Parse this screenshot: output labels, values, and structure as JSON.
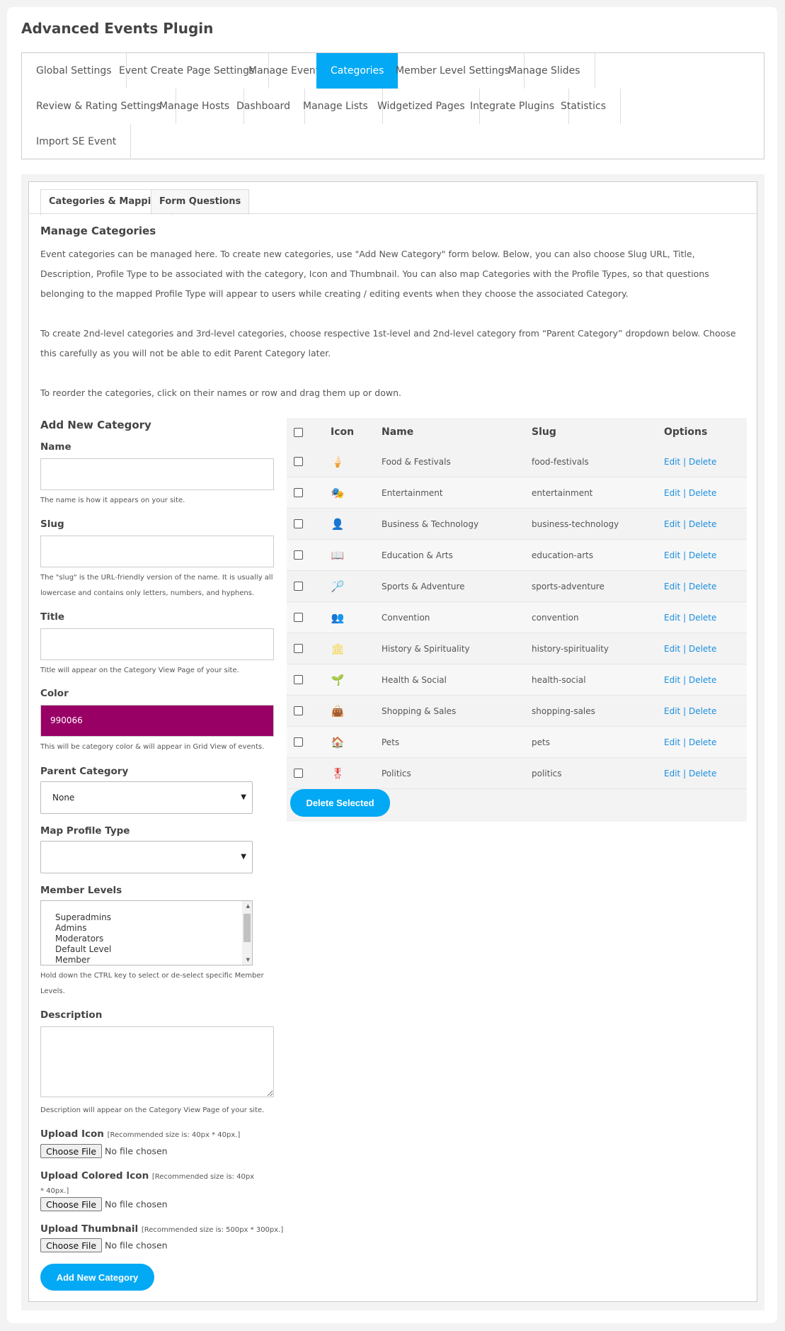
{
  "title": "Advanced Events Plugin",
  "tabs": [
    {
      "label": "Global Settings"
    },
    {
      "label": "Event Create Page Settings"
    },
    {
      "label": "Manage Events"
    },
    {
      "label": "Categories",
      "active": true
    },
    {
      "label": "Member Level Settings"
    },
    {
      "label": "Manage Slides"
    },
    {
      "label": "Review & Rating Settings"
    },
    {
      "label": "Manage Hosts"
    },
    {
      "label": "Dashboard"
    },
    {
      "label": "Manage Lists"
    },
    {
      "label": "Widgetized Pages"
    },
    {
      "label": "Integrate Plugins"
    },
    {
      "label": "Statistics"
    },
    {
      "label": "Import SE Event"
    }
  ],
  "subtabs": [
    {
      "label": "Categories & Mapping",
      "active": true
    },
    {
      "label": "Form Questions"
    }
  ],
  "heading": "Manage Categories",
  "paragraphs": [
    "Event categories can be managed here. To create new categories, use \"Add New Category\" form below. Below, you can also choose Slug URL, Title, Description, Profile Type to be associated with the category, Icon and Thumbnail. You can also map Categories with the Profile Types, so that questions belonging to the mapped Profile Type will appear to users while creating / editing events when they choose the associated Category.",
    "To create 2nd-level categories and 3rd-level categories, choose respective 1st-level and 2nd-level category from “Parent Category” dropdown below. Choose this carefully as you will not be able to edit Parent Category later.",
    "To reorder the categories, click on their names or row and drag them up or down."
  ],
  "form": {
    "heading": "Add New Category",
    "name_label": "Name",
    "name_value": "",
    "name_hint": "The name is how it appears on your site.",
    "slug_label": "Slug",
    "slug_value": "",
    "slug_hint": "The \"slug\" is the URL-friendly version of the name. It is usually all lowercase and contains only letters, numbers, and hyphens.",
    "title_label": "Title",
    "title_value": "",
    "title_hint": "Title will appear on the Category View Page of your site.",
    "color_label": "Color",
    "color_value": "990066",
    "color_hex": "#990066",
    "color_hint": "This will be category color & will appear in Grid View of events.",
    "parent_label": "Parent Category",
    "parent_value": "None",
    "profile_label": "Map Profile Type",
    "profile_value": "",
    "levels_label": "Member Levels",
    "levels": [
      "Superadmins",
      "Admins",
      "Moderators",
      "Default Level",
      "Member"
    ],
    "levels_hint": "Hold down the CTRL key to select or de-select specific Member Levels.",
    "desc_label": "Description",
    "desc_hint": "Description will appear on the Category View Page of your site.",
    "icon_label": "Upload Icon",
    "icon_note": "[Recommended size is: 40px * 40px.]",
    "colored_label": "Upload Colored Icon",
    "colored_note": "[Recommended size is: 40px * 40px.]",
    "thumb_label": "Upload Thumbnail",
    "thumb_note": "[Recommended size is: 500px * 300px.]",
    "choose_file": "Choose File",
    "no_file": "No file chosen",
    "submit": "Add New Category"
  },
  "table": {
    "headers": {
      "icon": "Icon",
      "name": "Name",
      "slug": "Slug",
      "options": "Options"
    },
    "edit": "Edit",
    "sep": "|",
    "delete": "Delete",
    "rows": [
      {
        "name": "Food & Festivals",
        "slug": "food-festivals",
        "icon": "food-icon",
        "glyph": "🍦",
        "color": "#e57373"
      },
      {
        "name": "Entertainment",
        "slug": "entertainment",
        "icon": "theater-masks-icon",
        "glyph": "🎭",
        "color": "#9ccc65"
      },
      {
        "name": "Business & Technology",
        "slug": "business-technology",
        "icon": "businessman-icon",
        "glyph": "👤",
        "color": "#f0a030"
      },
      {
        "name": "Education & Arts",
        "slug": "education-arts",
        "icon": "book-icon",
        "glyph": "📖",
        "color": "#7a8ca0"
      },
      {
        "name": "Sports & Adventure",
        "slug": "sports-adventure",
        "icon": "racket-icon",
        "glyph": "🏸",
        "color": "#444"
      },
      {
        "name": "Convention",
        "slug": "convention",
        "icon": "people-icon",
        "glyph": "👥",
        "color": "#f5b030"
      },
      {
        "name": "History & Spirituality",
        "slug": "history-spirituality",
        "icon": "temple-icon",
        "glyph": "🏛",
        "color": "#f5d54a"
      },
      {
        "name": "Health & Social",
        "slug": "health-social",
        "icon": "plant-bowl-icon",
        "glyph": "🌱",
        "color": "#6d4c41"
      },
      {
        "name": "Shopping & Sales",
        "slug": "shopping-sales",
        "icon": "shopping-bag-icon",
        "glyph": "👜",
        "color": "#333"
      },
      {
        "name": "Pets",
        "slug": "pets",
        "icon": "pet-house-icon",
        "glyph": "🏠",
        "color": "#26a6c9"
      },
      {
        "name": "Politics",
        "slug": "politics",
        "icon": "award-ribbon-icon",
        "glyph": "🎖",
        "color": "#e53935"
      }
    ],
    "delete_selected": "Delete Selected"
  },
  "accent": "#03a9f4"
}
